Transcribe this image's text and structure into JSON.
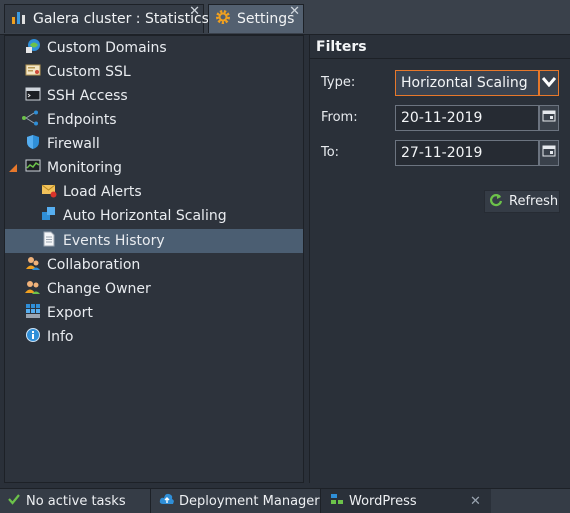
{
  "tabs": [
    {
      "label": "Galera cluster : Statistics",
      "icon": "bar-chart-icon"
    },
    {
      "label": "Settings",
      "icon": "gear-icon",
      "active": true
    }
  ],
  "tree": [
    {
      "label": "Custom Domains",
      "icon": "globe-icon"
    },
    {
      "label": "Custom SSL",
      "icon": "certificate-icon"
    },
    {
      "label": "SSH Access",
      "icon": "terminal-icon"
    },
    {
      "label": "Endpoints",
      "icon": "endpoints-icon"
    },
    {
      "label": "Firewall",
      "icon": "shield-icon"
    },
    {
      "label": "Monitoring",
      "icon": "monitor-icon",
      "expanded": true
    },
    {
      "label": "Load Alerts",
      "icon": "mail-alert-icon"
    },
    {
      "label": "Auto Horizontal Scaling",
      "icon": "cubes-icon"
    },
    {
      "label": "Events History",
      "icon": "document-icon",
      "selected": true
    },
    {
      "label": "Collaboration",
      "icon": "users-icon"
    },
    {
      "label": "Change Owner",
      "icon": "change-owner-icon"
    },
    {
      "label": "Export",
      "icon": "export-icon"
    },
    {
      "label": "Info",
      "icon": "info-icon"
    }
  ],
  "filters": {
    "title": "Filters",
    "type_label": "Type:",
    "type_value": "Horizontal Scaling",
    "from_label": "From:",
    "from_value": "20-11-2019",
    "to_label": "To:",
    "to_value": "27-11-2019",
    "refresh_label": "Refresh"
  },
  "status": {
    "tasks": "No active tasks",
    "deployment_manager": "Deployment Manager",
    "wordpress": "WordPress"
  },
  "colors": {
    "accent": "#e7782b",
    "selected": "#4b5e72",
    "background": "#2a3039"
  }
}
